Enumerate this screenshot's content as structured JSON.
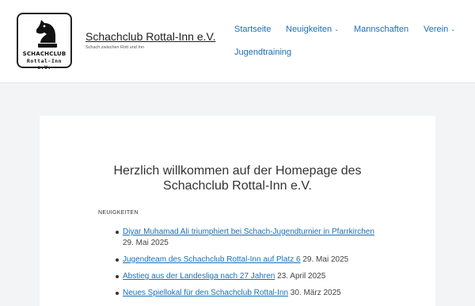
{
  "site": {
    "logo_line1": "SCHACHCLUB",
    "logo_line2": "Rottal-Inn e.V.",
    "title": "Schachclub Rottal-Inn e.V.",
    "tagline": "Schach zwischen Rott und Inn"
  },
  "nav": {
    "startseite": "Startseite",
    "neuigkeiten": "Neuigkeiten",
    "mannschaften": "Mannschaften",
    "verein": "Verein",
    "jugendtraining": "Jugendtraining",
    "chevron": "⌄"
  },
  "main": {
    "heading_line1": "Herzlich willkommen auf der Homepage des",
    "heading_line2": "Schachclub Rottal-Inn e.V.",
    "section_label": "NEUIGKEITEN",
    "news": [
      {
        "title": "Diyar Muhamad Ali triumphiert bei Schach-Jugendturnier in Pfarrkirchen",
        "date": "29. Mai 2025"
      },
      {
        "title": "Jugendteam des Schachclub Rottal-Inn auf Platz 6",
        "date": "29. Mai 2025"
      },
      {
        "title": "Abstieg aus der Landesliga nach 27 Jahren",
        "date": "23. April 2025"
      },
      {
        "title": "Neues Spiellokal für den Schachclub Rottal-Inn",
        "date": "30. März 2025"
      }
    ]
  },
  "colors": {
    "link": "#1a6fb5",
    "background": "#f3f4f6",
    "card": "#ffffff"
  },
  "icons": {
    "logo": "chess-knight-icon"
  }
}
